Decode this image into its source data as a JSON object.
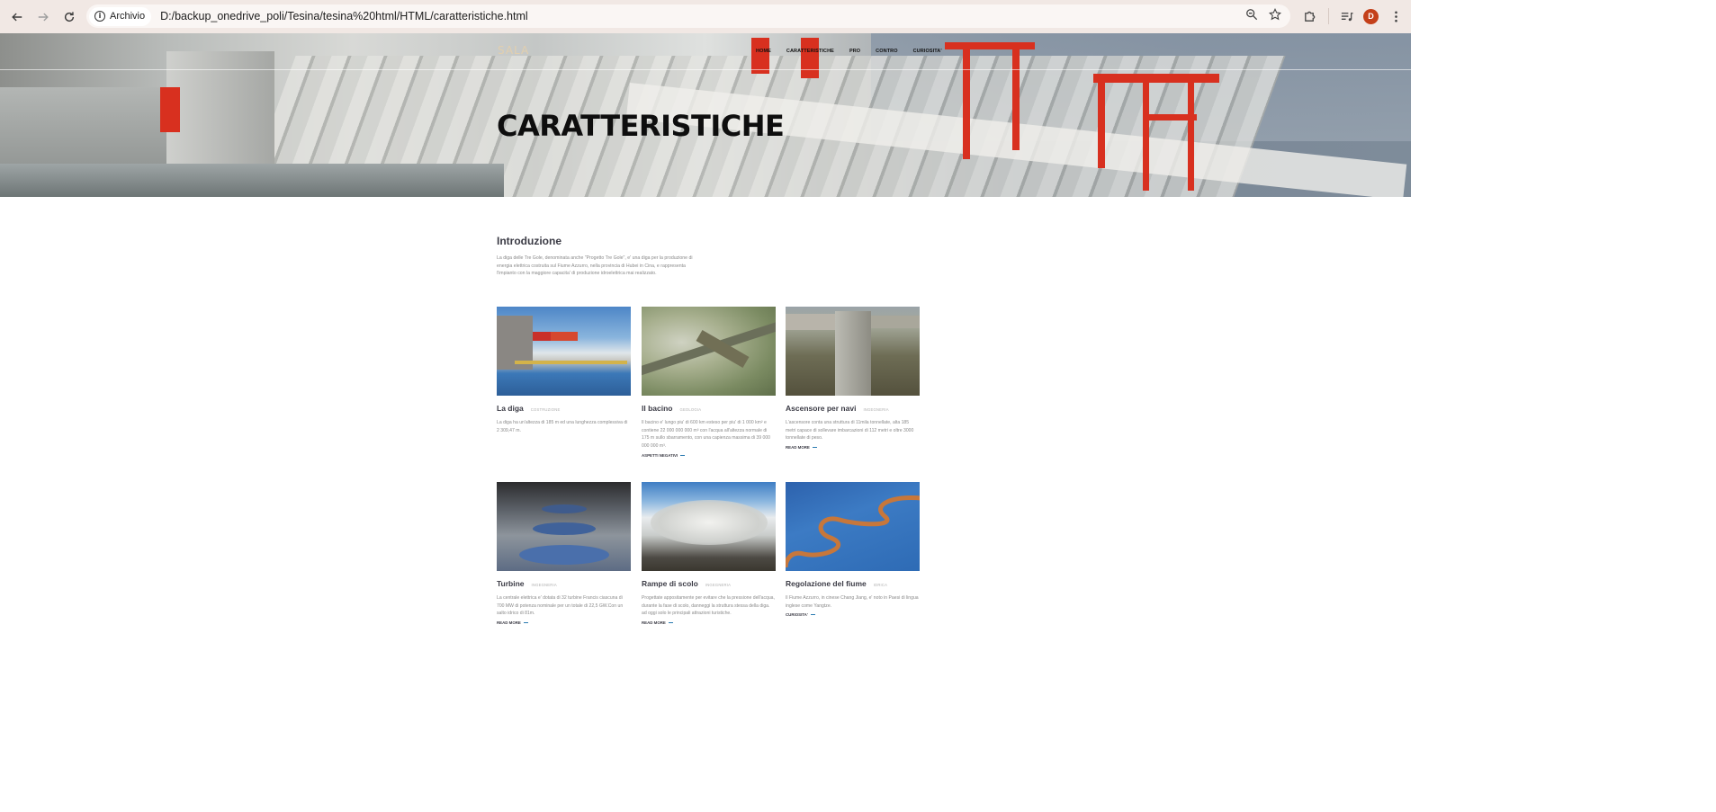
{
  "browser": {
    "chip_label": "Archivio",
    "url": "D:/backup_onedrive_poli/Tesina/tesina%20html/HTML/caratteristiche.html",
    "avatar_letter": "D"
  },
  "site": {
    "logo": "SALA",
    "nav": [
      "HOME",
      "CARATTERISTICHE",
      "PRO",
      "CONTRO",
      "CURIOSITA'"
    ],
    "hero_title": "CARATTERISTICHE"
  },
  "intro": {
    "title": "Introduzione",
    "text": "La diga delle Tre Gole, denominata anche \"Progetto Tre Gole\", e' una diga per la produzione di energia elettrica costruita sul Fiume Azzurro, nella provincia di Hubei in Cina, e rappresenta l'impianto con la maggiore capacita' di produzione idroelettrica mai realizzato."
  },
  "cards": [
    {
      "title": "La diga",
      "tag": "COSTRUZIONE",
      "text": "La diga ha un'altezza di 185 m ed una lunghezza complessiva di 2 309,47 m.",
      "link": ""
    },
    {
      "title": "Il bacino",
      "tag": "GEOLOGIA",
      "text": "Il bacino e' lungo piu' di 600 km esteso per piu' di 1 000 km² e contiene 22 000 000 000 m³ con l'acqua all'altezza normale di 175 m sullo sbarramento, con una capienza massima di 39 000 000 000 m³.",
      "link": "ASPETTI NEGATIVI"
    },
    {
      "title": "Ascensore per navi",
      "tag": "INGEGNERIA",
      "text": "L'ascensore conta una struttura di 11mila tonnellate, alta 185 metri capace di sollevare imbarcazioni di 112 metri e oltre 3000 tonnellate di peso.",
      "link": "READ MORE"
    },
    {
      "title": "Turbine",
      "tag": "INGEGNERIA",
      "text": "La centrale elettrica e' dotata di 32 turbine Francis ciascuna di 700 MW di potenza nominale per un totale di 22,5 GW.Con un salto idrico di 81m.",
      "link": "READ MORE"
    },
    {
      "title": "Rampe di scolo",
      "tag": "INGEGNERIA",
      "text": "Progettate appositamente per evitare che la pressione dell'acqua, durante la fase di scolo, danneggi la struttura stessa della diga. ad oggi solo le principali attrazioni turistiche.",
      "link": "READ MORE"
    },
    {
      "title": "Regolazione del fiume",
      "tag": "IDRICA",
      "text": "Il Fiume Azzurro, in cinese Chang Jiang, e' noto in Paesi di lingua inglese come Yangtze.",
      "link": "CURIOSITA'"
    }
  ]
}
